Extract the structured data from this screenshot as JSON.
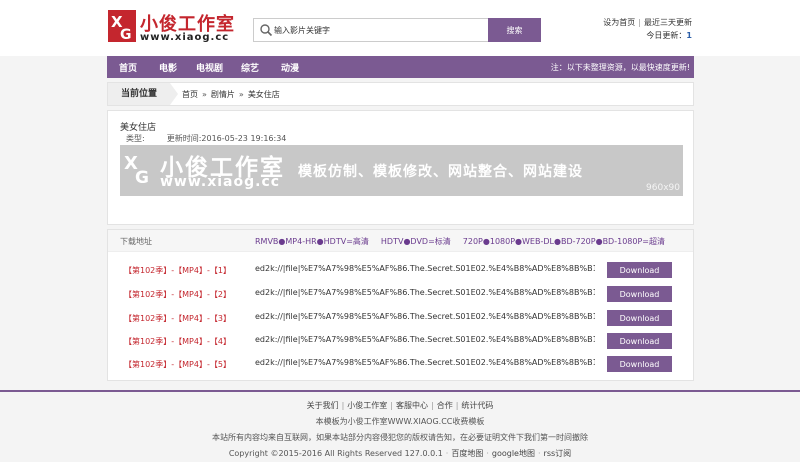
{
  "header": {
    "logo_title": "小俊工作室",
    "logo_url": "www.xiaog.cc",
    "search_placeholder": "输入影片关键字",
    "search_button": "搜索",
    "top_links": {
      "set_home": "设为首页",
      "latest": "最近三天更新",
      "today_label": "今日更新：",
      "today_count": "1"
    }
  },
  "nav": {
    "items": [
      "首页",
      "电影",
      "电视剧",
      "综艺",
      "动漫"
    ],
    "note": "注：以下未整理资源，以最快速度更新!"
  },
  "breadcrumb": {
    "label": "当前位置",
    "path": [
      "首页",
      "剧情片",
      "美女住店"
    ]
  },
  "detail": {
    "title": "美女住店",
    "type_label": "类型:",
    "update_label": "更新时间:",
    "update_time": "2016-05-23 19:16:34",
    "banner": {
      "title": "小俊工作室",
      "url": "www.xiaog.cc",
      "slogan": "模板仿制、模板修改、网站整合、网站建设",
      "size": "960x90"
    }
  },
  "downloads": {
    "label": "下载地址",
    "formats": [
      "RMVB●MP4-HR●HDTV=高清",
      "HDTV●DVD=标清",
      "720P●1080P●WEB-DL●BD-720P●BD-1080P=超清"
    ],
    "rows": [
      {
        "episode": "【第102季】-【MP4】-【1】",
        "link": "ed2k://|file|%E7%A7%98%E5%AF%86.The.Secret.S01E02.%E4%B8%AD%E8%8B%B1%E5%AD",
        "button": "Download"
      },
      {
        "episode": "【第102季】-【MP4】-【2】",
        "link": "ed2k://|file|%E7%A7%98%E5%AF%86.The.Secret.S01E02.%E4%B8%AD%E8%8B%B1%E5%AD",
        "button": "Download"
      },
      {
        "episode": "【第102季】-【MP4】-【3】",
        "link": "ed2k://|file|%E7%A7%98%E5%AF%86.The.Secret.S01E02.%E4%B8%AD%E8%8B%B1%E5%AD",
        "button": "Download"
      },
      {
        "episode": "【第102季】-【MP4】-【4】",
        "link": "ed2k://|file|%E7%A7%98%E5%AF%86.The.Secret.S01E02.%E4%B8%AD%E8%8B%B1%E5%AD",
        "button": "Download"
      },
      {
        "episode": "【第102季】-【MP4】-【5】",
        "link": "ed2k://|file|%E7%A7%98%E5%AF%86.The.Secret.S01E02.%E4%B8%AD%E8%8B%B1%E5%AD",
        "button": "Download"
      }
    ]
  },
  "footer": {
    "links": [
      "关于我们",
      "小俊工作室",
      "客服中心",
      "合作",
      "统计代码"
    ],
    "line2": "本模板为小俊工作室WWW.XIAOG.CC收费模板",
    "line3": "本站所有内容均来自互联网，如果本站部分内容侵犯您的版权请告知，在必要证明文件下我们第一时间撤除",
    "copyright": "Copyright ©2015-2016 All Rights Reserved 127.0.0.1",
    "sitemaps": [
      "百度地图",
      "google地图",
      "rss订阅"
    ]
  },
  "colors": {
    "brand": "#7b5a92",
    "accent_red": "#c4262e",
    "format_purple": "#6a3b8e"
  }
}
